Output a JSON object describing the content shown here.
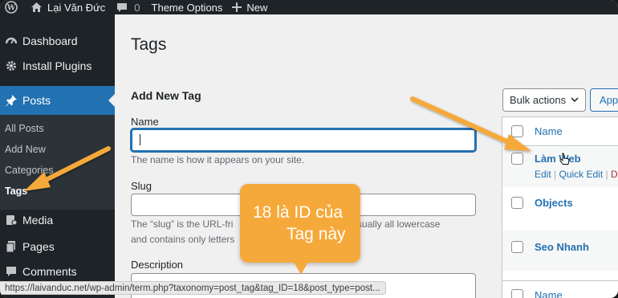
{
  "admin_bar": {
    "site_name": "Lại Văn Đức",
    "comments_count": "0",
    "theme_options": "Theme Options",
    "new_label": "New"
  },
  "sidebar": {
    "dashboard": "Dashboard",
    "install_plugins": "Install Plugins",
    "posts": "Posts",
    "submenu": [
      "All Posts",
      "Add New",
      "Categories",
      "Tags"
    ],
    "media": "Media",
    "pages": "Pages",
    "comments": "Comments"
  },
  "page": {
    "title": "Tags",
    "form_title": "Add New Tag",
    "name_label": "Name",
    "name_value": "",
    "name_help": "The name is how it appears on your site.",
    "slug_label": "Slug",
    "slug_help_1": "The “slug” is the URL-fri",
    "slug_help_1b": "It is usually all lowercase",
    "slug_help_2": "and contains only letters",
    "description_label": "Description"
  },
  "table": {
    "bulk_actions": "Bulk actions",
    "apply": "Apply",
    "column_name": "Name",
    "rows": [
      {
        "name": "Làm Web",
        "actions": [
          "Edit",
          "Quick Edit"
        ]
      },
      {
        "name": "Objects"
      },
      {
        "name": "Seo Nhanh"
      }
    ],
    "footer_name": "Name"
  },
  "callout": {
    "line1": "18 là ID của",
    "line2": "Tag này"
  },
  "status_bar": {
    "url": "https://laivanduc.net/wp-admin/term.php?taxonomy=post_tag&tag_ID=18&post_type=post..."
  },
  "colors": {
    "admin_dark": "#1d2327",
    "wp_blue": "#2271b1",
    "callout_orange": "#f6a93b"
  }
}
